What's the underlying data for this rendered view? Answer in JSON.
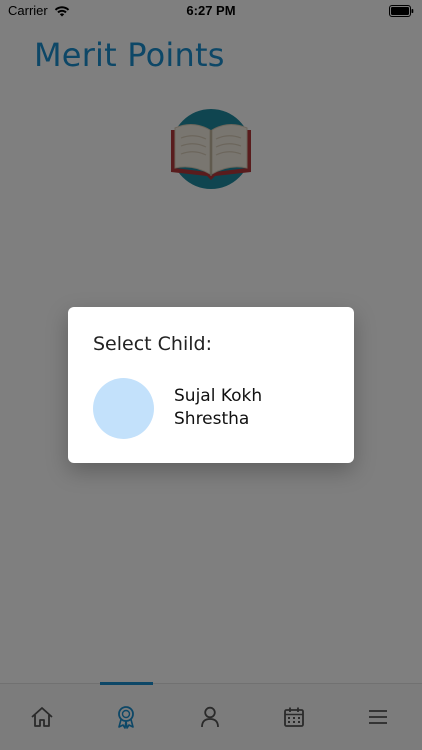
{
  "status_bar": {
    "carrier": "Carrier",
    "time": "6:27 PM",
    "icons": [
      "wifi-icon",
      "battery-icon"
    ]
  },
  "page": {
    "title": "Merit Points",
    "logo_icon": "open-book-icon"
  },
  "tab_bar": {
    "active_index": 1,
    "tabs": [
      {
        "icon": "home-icon"
      },
      {
        "icon": "award-icon"
      },
      {
        "icon": "profile-icon"
      },
      {
        "icon": "calendar-icon"
      },
      {
        "icon": "menu-icon"
      }
    ]
  },
  "dialog": {
    "title": "Select Child:",
    "children": [
      {
        "name": "Sujal Kokh Shrestha"
      }
    ]
  },
  "colors": {
    "accent": "#1a8fce",
    "avatar_bg": "#c3e1fb",
    "overlay": "rgba(0,0,0,0.5)"
  }
}
